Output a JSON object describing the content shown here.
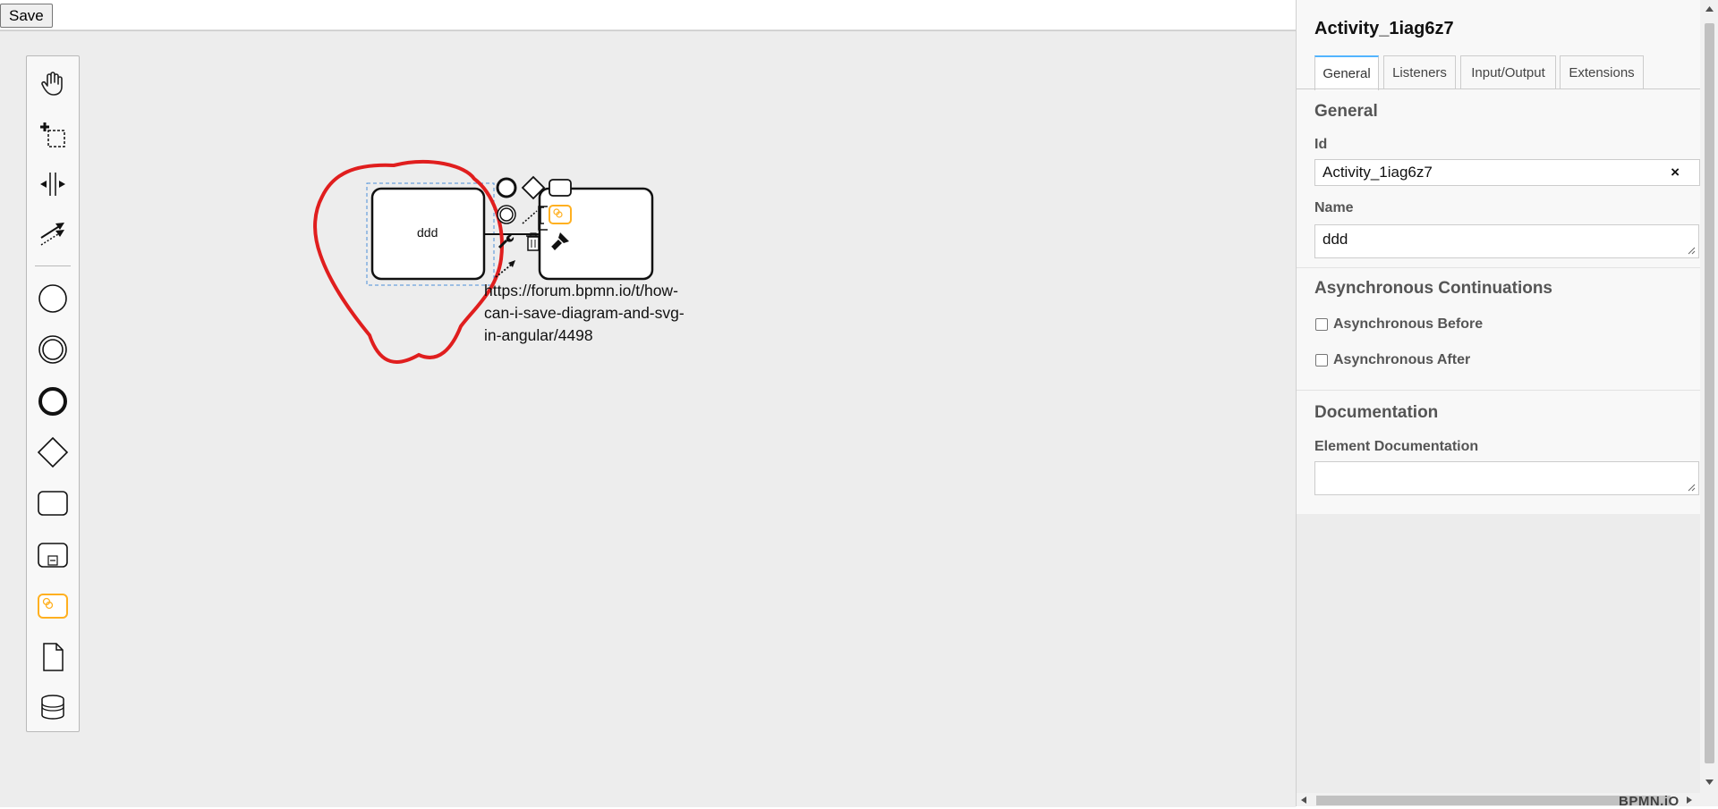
{
  "toolbar": {
    "save_label": "Save"
  },
  "palette": {
    "tools": [
      "hand-tool-icon",
      "lasso-tool-icon",
      "space-tool-icon",
      "global-connect-tool-icon",
      "start-event-icon",
      "intermediate-event-icon",
      "end-event-icon",
      "gateway-icon",
      "task-icon",
      "subprocess-icon",
      "service-task-icon",
      "data-object-icon",
      "data-store-icon"
    ]
  },
  "diagram": {
    "task_label": "ddd",
    "annotation_text": "https://forum.bpmn.io/t/how-can-i-save-diagram-and-svg-in-angular/4498",
    "annotation_lines": [
      "https://forum.bpmn.io/t/how-",
      "can-i-save-diagram-and-svg-",
      "in-angular/4498"
    ],
    "highlight_color": "#e01e1e",
    "selection_color": "#4a90d9",
    "service_color": "#ffb020"
  },
  "properties": {
    "title": "Activity_1iag6z7",
    "tabs": [
      "General",
      "Listeners",
      "Input/Output",
      "Extensions"
    ],
    "active_tab": "General",
    "general": {
      "group_title": "General",
      "id_label": "Id",
      "id_value": "Activity_1iag6z7",
      "clear_label": "×",
      "name_label": "Name",
      "name_value": "ddd"
    },
    "async": {
      "group_title": "Asynchronous Continuations",
      "before_label": "Asynchronous Before",
      "after_label": "Asynchronous After"
    },
    "documentation": {
      "group_title": "Documentation",
      "element_doc_label": "Element Documentation",
      "element_doc_value": ""
    }
  },
  "footer": {
    "logo_text": "BPMN.iO"
  },
  "accent_color": "#52b4ff"
}
